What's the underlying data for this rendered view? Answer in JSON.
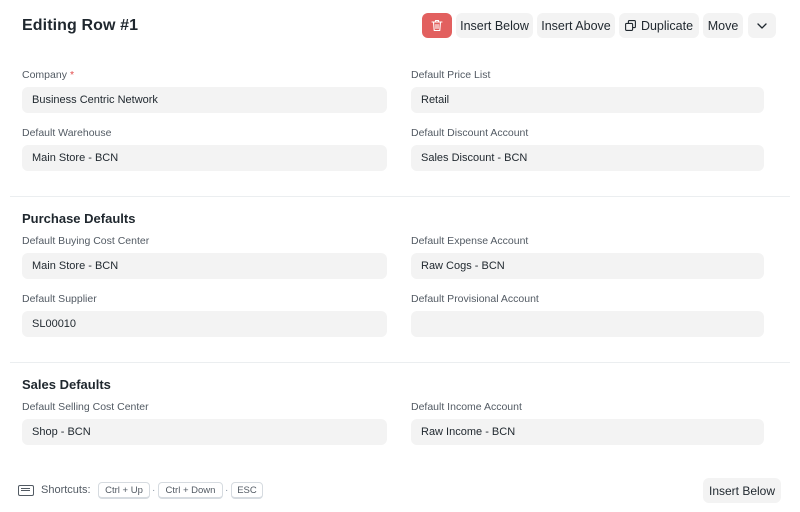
{
  "header": {
    "title": "Editing Row #1",
    "delete_icon": "trash-icon",
    "insert_below": "Insert Below",
    "insert_above": "Insert Above",
    "duplicate": "Duplicate",
    "duplicate_icon": "duplicate-icon",
    "move": "Move",
    "more_icon": "chevron-down-icon"
  },
  "colors": {
    "danger": "#e2605f",
    "required": "#e24c4c",
    "field_bg": "#f3f3f3"
  },
  "main": {
    "company_label": "Company",
    "company_required": "*",
    "company_value": "Business Centric Network",
    "default_price_list_label": "Default Price List",
    "default_price_list_value": "Retail",
    "default_warehouse_label": "Default Warehouse",
    "default_warehouse_value": "Main Store - BCN",
    "default_discount_account_label": "Default Discount Account",
    "default_discount_account_value": "Sales Discount - BCN"
  },
  "purchase": {
    "title": "Purchase Defaults",
    "buying_cost_center_label": "Default Buying Cost Center",
    "buying_cost_center_value": "Main Store - BCN",
    "expense_account_label": "Default Expense Account",
    "expense_account_value": "Raw Cogs - BCN",
    "supplier_label": "Default Supplier",
    "supplier_value": "SL00010",
    "provisional_account_label": "Default Provisional Account",
    "provisional_account_value": ""
  },
  "sales": {
    "title": "Sales Defaults",
    "selling_cost_center_label": "Default Selling Cost Center",
    "selling_cost_center_value": "Shop - BCN",
    "income_account_label": "Default Income Account",
    "income_account_value": "Raw Income - BCN"
  },
  "footer": {
    "shortcuts_icon": "keyboard-icon",
    "shortcuts_label": "Shortcuts:",
    "shortcut_1": "Ctrl + Up",
    "shortcut_2": "Ctrl + Down",
    "shortcut_3": "ESC",
    "separator": "·",
    "insert_below": "Insert Below"
  }
}
